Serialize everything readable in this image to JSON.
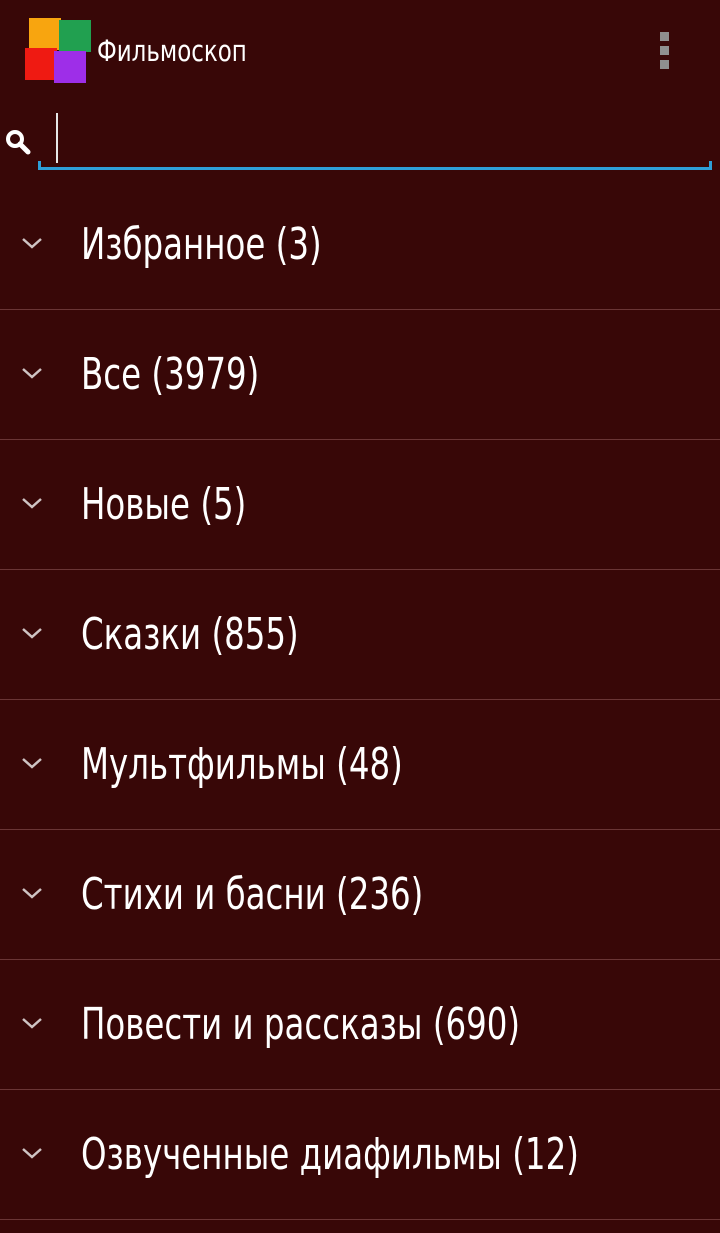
{
  "app": {
    "title": "Фильмоскоп"
  },
  "search": {
    "value": "",
    "placeholder": ""
  },
  "categories": [
    {
      "label": "Избранное (3)"
    },
    {
      "label": "Все (3979)"
    },
    {
      "label": "Новые (5)"
    },
    {
      "label": "Сказки (855)"
    },
    {
      "label": "Мультфильмы (48)"
    },
    {
      "label": "Стихи и басни (236)"
    },
    {
      "label": "Повести и рассказы (690)"
    },
    {
      "label": "Озвученные диафильмы (12)"
    }
  ],
  "icons": {
    "logo": "app-logo-icon",
    "overflow": "overflow-menu-icon",
    "search": "search-icon",
    "expand": "chevron-down-icon"
  },
  "colors": {
    "background": "#380707",
    "divider": "#6a3535",
    "accent": "#2e9fd8",
    "logo_orange": "#f8a50f",
    "logo_green": "#21a050",
    "logo_red": "#ef1a12",
    "logo_purple": "#9e2ee8"
  }
}
